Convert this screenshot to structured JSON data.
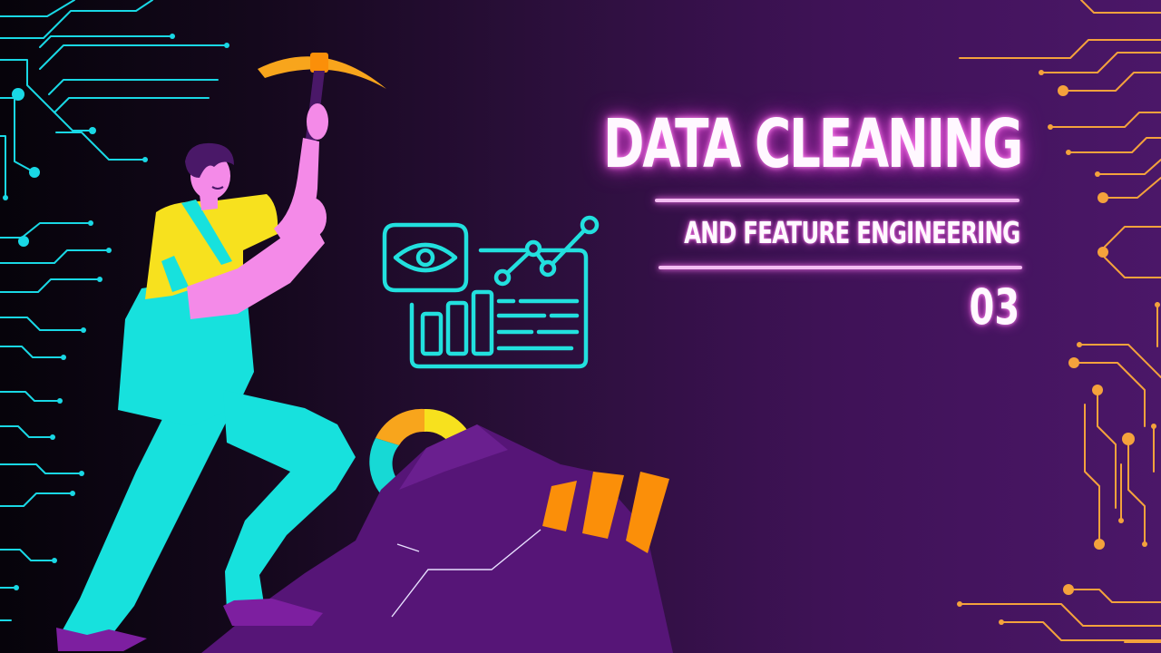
{
  "banner": {
    "title": "DATA CLEANING",
    "subtitle": "AND FEATURE ENGINEERING",
    "number": "03"
  },
  "colors": {
    "circuit_left": "#19d8e5",
    "circuit_right": "#f4a23c",
    "glow_text": "#fff8ff",
    "glow_accent": "#e34bd4",
    "rule": "#f3bdf2",
    "skin": "#f48ae8",
    "shirt": "#f7e11e",
    "overalls": "#17e1dd",
    "hair": "#4a1868",
    "pickaxe": "#f8a51c",
    "rock": "#561577",
    "bars": "#fb8f09",
    "dashboard_icon": "#22e0de"
  },
  "icons": [
    "circuit-left-icon",
    "circuit-right-icon",
    "dashboard-icon",
    "eye-icon",
    "bar-chart-icon",
    "trend-line-icon",
    "donut-chart-icon",
    "rock-icon",
    "orange-bars-icon",
    "worker-illustration",
    "pickaxe-icon"
  ]
}
